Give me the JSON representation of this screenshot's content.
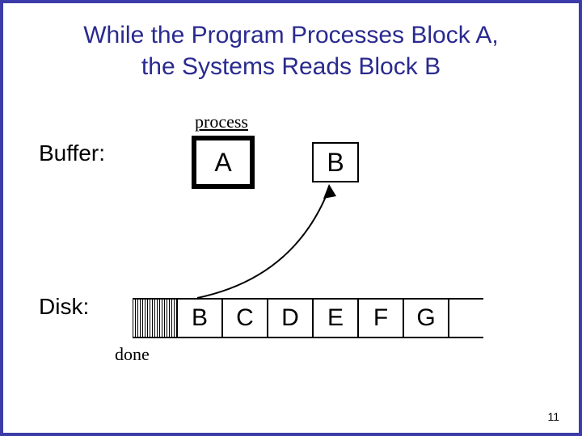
{
  "title_line1": "While the Program Processes Block A,",
  "title_line2": "the Systems Reads Block B",
  "process_label": "process",
  "buffer_label": "Buffer:",
  "disk_label": "Disk:",
  "done_label": "done",
  "buf_a": "A",
  "buf_b": "B",
  "disk": {
    "c0": "B",
    "c1": "C",
    "c2": "D",
    "c3": "E",
    "c4": "F",
    "c5": "G"
  },
  "page_num": "11"
}
